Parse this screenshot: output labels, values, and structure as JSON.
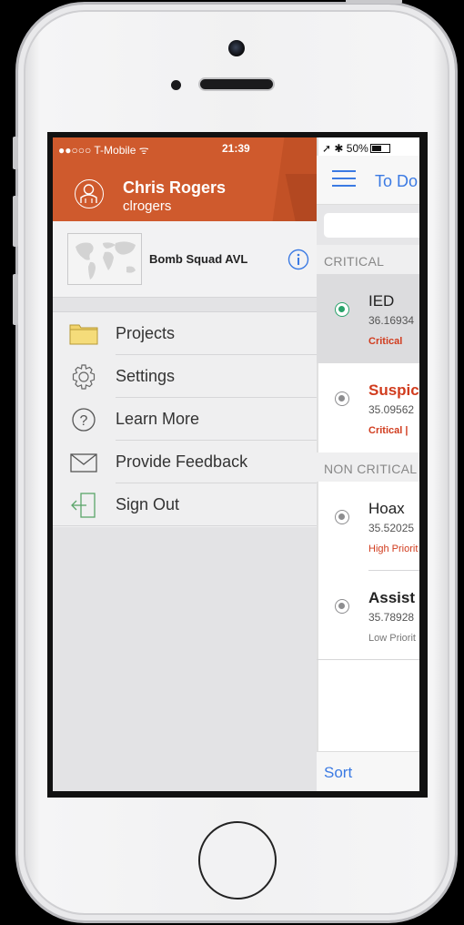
{
  "status_bar": {
    "carrier": "●●○○○ T-Mobile ᯤ",
    "time": "21:39",
    "right": "➚ ✱ 50%"
  },
  "user": {
    "name": "Chris Rogers",
    "username": "clrogers"
  },
  "project": {
    "name": "Bomb Squad AVL"
  },
  "menu": [
    {
      "label": "Projects",
      "icon": "folder-icon"
    },
    {
      "label": "Settings",
      "icon": "gear-icon"
    },
    {
      "label": "Learn More",
      "icon": "question-icon"
    },
    {
      "label": "Provide Feedback",
      "icon": "envelope-icon"
    },
    {
      "label": "Sign Out",
      "icon": "sign-out-icon"
    }
  ],
  "main": {
    "title": "To Do",
    "sections": {
      "critical": "CRITICAL",
      "non_critical": "NON CRITICAL"
    },
    "items": [
      {
        "title": "IED",
        "coord": "36.16934",
        "tag": "Critical"
      },
      {
        "title": "Suspic",
        "coord": "35.09562",
        "tag": "Critical  |"
      },
      {
        "title": "Hoax",
        "coord": "35.52025",
        "tag": "High Priorit"
      },
      {
        "title": "Assist",
        "coord": "35.78928",
        "tag": "Low Priorit"
      }
    ],
    "sort_label": "Sort"
  },
  "colors": {
    "drawer_header": "#cf5a2d",
    "accent_blue": "#3b7ae3",
    "critical_red": "#d13c1e",
    "selected_green": "#2aa36b"
  }
}
